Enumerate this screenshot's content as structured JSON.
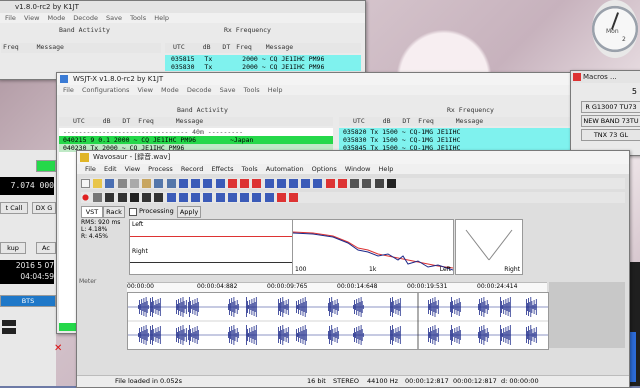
{
  "colors": {
    "cyan": "#7ff2ee",
    "green": "#25d84a",
    "wave": "#1d2a8a",
    "red": "#e32020"
  },
  "back_wsjt": {
    "title": "v1.8.0-rc2   by K1JT",
    "menu": [
      "File",
      "View",
      "Mode",
      "Decode",
      "Save",
      "Tools",
      "Help"
    ],
    "band_activity": "Band Activity",
    "rx_frequency": "Rx Frequency",
    "left_headers": [
      "Freq",
      "Message"
    ],
    "right_headers": [
      "UTC",
      "dB",
      "DT",
      "Freq",
      "Message"
    ],
    "rows": [
      {
        "utc": "035815",
        "db": "Tx",
        "dt": "",
        "freq": "2000",
        "msg": "CQ JE1IHC PM96"
      },
      {
        "utc": "035830",
        "db": "Tx",
        "dt": "",
        "freq": "2000",
        "msg": "CQ JE1IHC PM96"
      }
    ]
  },
  "front_wsjt": {
    "title": "WSJT-X   v1.8.0-rc2   by K1JT",
    "menu": [
      "File",
      "Configurations",
      "View",
      "Mode",
      "Decode",
      "Save",
      "Tools",
      "Help"
    ],
    "band_activity": "Band Activity",
    "rx_frequency": "Rx Frequency",
    "headers": [
      "UTC",
      "dB",
      "DT",
      "Freq",
      "Message"
    ],
    "band_line": "-------------------------------- 40m ---------",
    "left_rows": [
      {
        "text": "040215  9  0.1 2000 ~  CQ JE1IHC PM96",
        "extra": "~Japan"
      },
      {
        "text": "040230  Tx          2000 ~  CQ JE1IHC PM96",
        "extra": ""
      }
    ],
    "right_rows": [
      {
        "text": "035820  Tx          1500 ~  CQ-1MG JE1IHC"
      },
      {
        "text": "035830  Tx          1500 ~  CQ-1MG JE1IHC"
      },
      {
        "text": "035845  Tx          1500 ~  CQ-1MG JE1IHC"
      }
    ]
  },
  "left_panel": {
    "freq": "7.074 000",
    "call_label": "t Call",
    "dx_label": "DX G",
    "lookup": "kup",
    "add": "Ac",
    "date": "2016 5 07",
    "time": "04:04:59",
    "bts": "BTS"
  },
  "macros": {
    "title": "Macros ...",
    "items": [
      "R G13007 TU73",
      "NEW BAND 73TU",
      "TNX 73 GL"
    ],
    "digit": "5"
  },
  "clock": {
    "day": "Mon",
    "num": "2"
  },
  "wavosaur": {
    "title": "Wavosaur - [録音.wav]",
    "menu": [
      "File",
      "Edit",
      "View",
      "Process",
      "Record",
      "Effects",
      "Tools",
      "Automation",
      "Options",
      "Window",
      "Help"
    ],
    "tabs": [
      "VST",
      "Rack"
    ],
    "processing": "Processing",
    "apply": "Apply",
    "rms": "RMS: 920 ms",
    "l_val": "L: 4.18%",
    "r_val": "R: 4.45%",
    "scope_left": "Left",
    "scope_right": "Right",
    "spec_100": "100",
    "spec_1k": "1k",
    "spec_left": "Left",
    "spec_right": "Right",
    "meter": "Meter",
    "time_marks": [
      "00:00:00",
      "00:00:04:882",
      "00:00:09:765",
      "00:00:14:648",
      "00:00:19:531",
      "00:00:24:414",
      "00:00:29:296"
    ],
    "status_loaded": "File loaded in 0.052s",
    "status_bits": "16 bit",
    "status_stereo": "STEREO",
    "status_rate": "44100 Hz",
    "status_pos": "00:00:12:817",
    "status_sel": "00:00:12:817",
    "status_end": "d: 00:00:00"
  }
}
